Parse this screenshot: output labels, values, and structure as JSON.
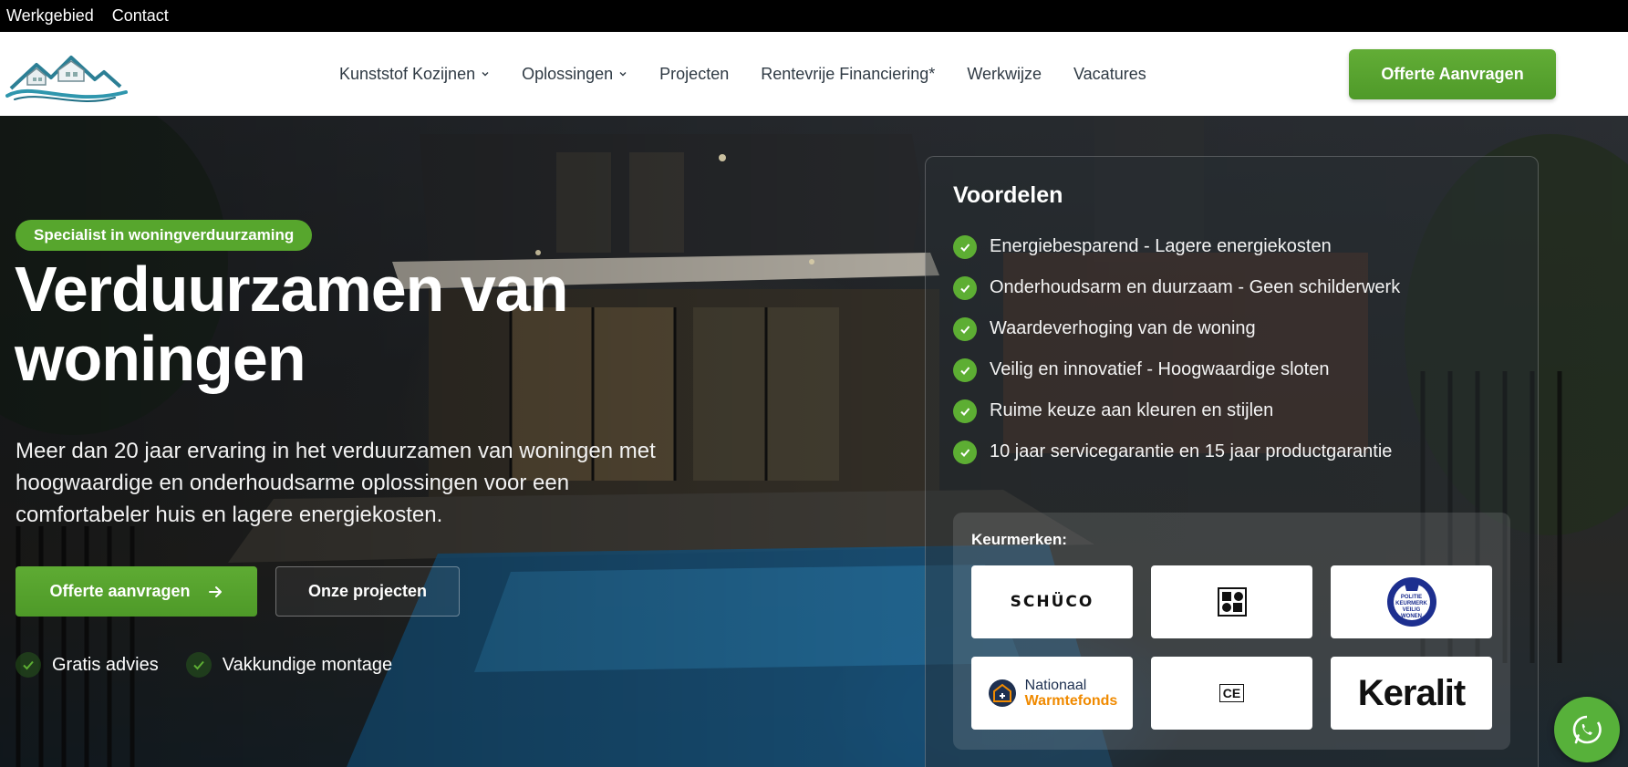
{
  "topbar": {
    "links": [
      "Werkgebied",
      "Contact"
    ]
  },
  "header": {
    "nav": [
      {
        "label": "Kunststof Kozijnen",
        "dropdown": true
      },
      {
        "label": "Oplossingen",
        "dropdown": true
      },
      {
        "label": "Projecten",
        "dropdown": false
      },
      {
        "label": "Rentevrije Financiering*",
        "dropdown": false
      },
      {
        "label": "Werkwijze",
        "dropdown": false
      },
      {
        "label": "Vacatures",
        "dropdown": false
      }
    ],
    "cta_label": "Offerte Aanvragen"
  },
  "hero": {
    "badge": "Specialist in woningverduurzaming",
    "title": "Verduurzamen van woningen",
    "lead": "Meer dan 20 jaar ervaring in het verduurzamen van woningen met hoogwaardige en onderhoudsarme oplossingen voor een comfortabeler huis en lagere energiekosten.",
    "primary_button": "Offerte aanvragen",
    "secondary_button": "Onze projecten",
    "perks": [
      "Gratis advies",
      "Vakkundige montage"
    ]
  },
  "benefits_card": {
    "title": "Voordelen",
    "items": [
      "Energiebesparend - Lagere energiekosten",
      "Onderhoudsarm en duurzaam - Geen schilderwerk",
      "Waardeverhoging van de woning",
      "Veilig en innovatief - Hoogwaardige sloten",
      "Ruime keuze aan kleuren en stijlen",
      "10 jaar servicegarantie en 15 jaar productgarantie"
    ],
    "keurmerken_title": "Keurmerken:",
    "logos": {
      "schuco": "SCHÜCO",
      "politie_lines": [
        "POLITIE",
        "KEURMERK",
        "VEILIG",
        "WONEN"
      ],
      "nwf_top": "Nationaal",
      "nwf_bottom": "Warmtefonds",
      "ce": "CE",
      "keralit": "Keralit"
    }
  },
  "colors": {
    "accent": "#57a62d",
    "header_bg": "#ffffff",
    "topbar_bg": "#000000"
  },
  "icons": {
    "whatsapp": "whatsapp-icon",
    "arrow": "arrow-right-icon",
    "check": "check-icon"
  }
}
